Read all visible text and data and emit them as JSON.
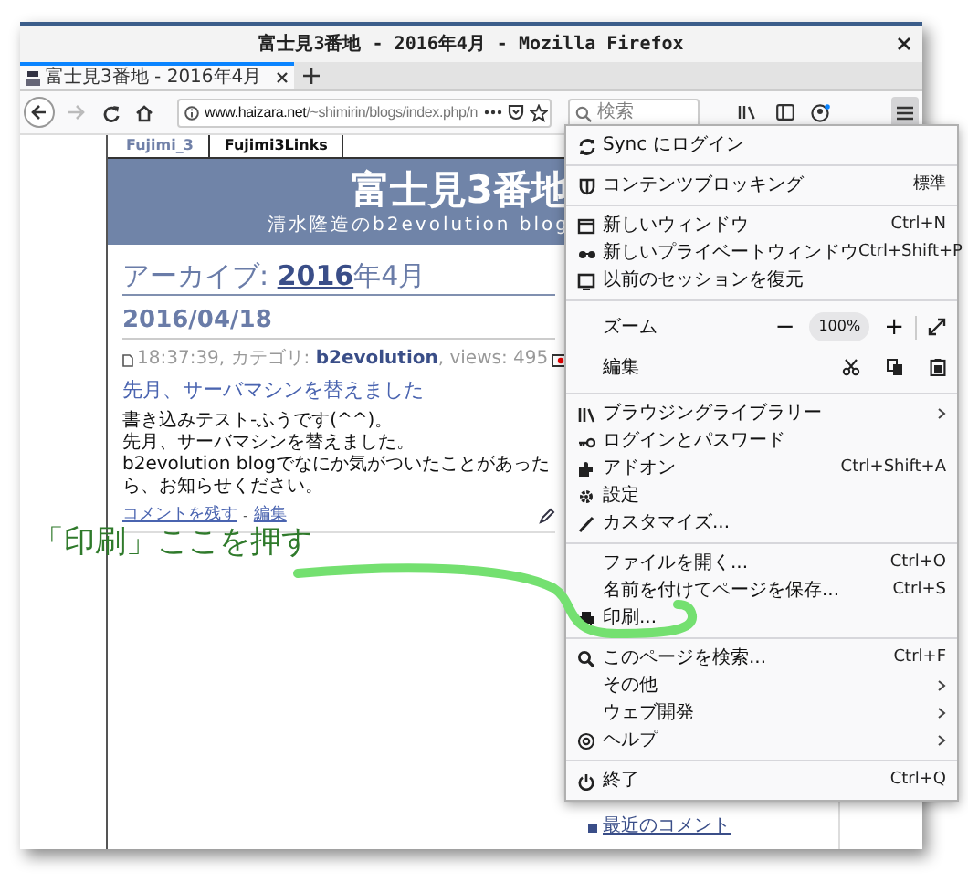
{
  "window": {
    "title": "富士見3番地 - 2016年4月 - Mozilla Firefox"
  },
  "tabs": [
    {
      "label": "富士見3番地 - 2016年4月",
      "selected": true
    }
  ],
  "toolbar": {
    "back": {
      "disabled": false
    },
    "forward": {
      "disabled": true
    },
    "url": {
      "host": "www.haizara.net",
      "path": "/~shimirin/blogs/index.php/n"
    },
    "search": {
      "placeholder": "検索"
    },
    "menu_button": {
      "selected": true
    }
  },
  "page": {
    "nav_tabs": [
      {
        "label": "Fujimi_3",
        "selected": true
      },
      {
        "label": "Fujimi3Links",
        "selected": false
      }
    ],
    "blog_title": "富士見3番地",
    "tagline": "清水隆造のb2evolution blog",
    "archive_heading": {
      "prefix": "アーカイブ: ",
      "link": "2016",
      "suffix": "年4月"
    },
    "date": "2016/04/18",
    "post": {
      "meta_prefix": "18:37:39, カテゴリ: ",
      "category": "b2evolution",
      "meta_suffix": ", views: 495",
      "title": "先月、サーバマシンを替えました",
      "body": [
        "書き込みテスト-ふうです(^^)。",
        "先月、サーバマシンを替えました。",
        "b2evolution blogでなにか気がついたことがあったら、お知らせください。"
      ],
      "links": [
        "コメントを残す",
        "編集"
      ],
      "link_separator": "-"
    },
    "sidebar_link": "最近のコメント"
  },
  "menu": {
    "sections": [
      [
        {
          "kind": "item",
          "label": "Sync にログイン"
        }
      ],
      [
        {
          "kind": "item",
          "label": "コンテンツブロッキング",
          "shortcut": "標準"
        }
      ],
      [
        {
          "kind": "item",
          "label": "新しいウィンドウ",
          "shortcut": "Ctrl+N"
        },
        {
          "kind": "item",
          "label": "新しいプライベートウィンドウ",
          "shortcut": "Ctrl+Shift+P"
        },
        {
          "kind": "item",
          "label": "以前のセッションを復元"
        }
      ],
      [
        {
          "kind": "zoom",
          "label": "ズーム",
          "minus": "−",
          "value": "100%",
          "plus": "+"
        },
        {
          "kind": "edit",
          "label": "編集"
        }
      ],
      [
        {
          "kind": "item",
          "label": "ブラウジングライブラリー",
          "submenu": true
        },
        {
          "kind": "item",
          "label": "ログインとパスワード"
        },
        {
          "kind": "item",
          "label": "アドオン",
          "shortcut": "Ctrl+Shift+A"
        },
        {
          "kind": "item",
          "label": "設定"
        },
        {
          "kind": "item",
          "label": "カスタマイズ..."
        }
      ],
      [
        {
          "kind": "item",
          "label": "ファイルを開く...",
          "shortcut": "Ctrl+O"
        },
        {
          "kind": "item",
          "label": "名前を付けてページを保存...",
          "shortcut": "Ctrl+S"
        },
        {
          "kind": "item",
          "label": "印刷..."
        }
      ],
      [
        {
          "kind": "item",
          "label": "このページを検索...",
          "shortcut": "Ctrl+F"
        },
        {
          "kind": "item",
          "label": "その他",
          "submenu": true
        },
        {
          "kind": "item",
          "label": "ウェブ開発",
          "submenu": true
        },
        {
          "kind": "item",
          "label": "ヘルプ",
          "submenu": true
        }
      ],
      [
        {
          "kind": "item",
          "label": "終了",
          "shortcut": "Ctrl+Q"
        }
      ]
    ]
  },
  "annotation": {
    "text": "「印刷」ここを押す"
  }
}
